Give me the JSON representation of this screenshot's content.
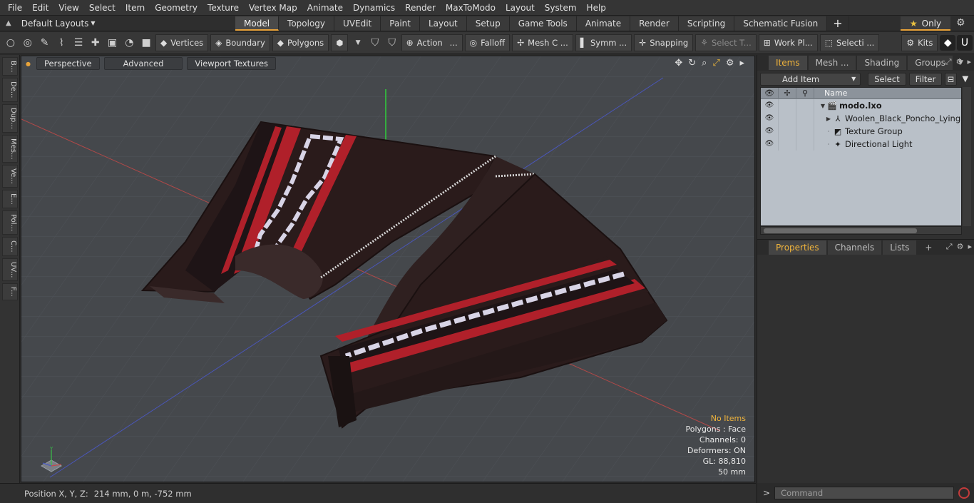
{
  "menu": [
    "File",
    "Edit",
    "View",
    "Select",
    "Item",
    "Geometry",
    "Texture",
    "Vertex Map",
    "Animate",
    "Dynamics",
    "Render",
    "MaxToModo",
    "Layout",
    "System",
    "Help"
  ],
  "layouts": {
    "label": "Default Layouts",
    "tabs": [
      "Model",
      "Topology",
      "UVEdit",
      "Paint",
      "Layout",
      "Setup",
      "Game Tools",
      "Animate",
      "Render",
      "Scripting",
      "Schematic Fusion"
    ],
    "active_tab": "Model",
    "plus": "+",
    "only_label": "Only"
  },
  "toolbar": {
    "vertices": "Vertices",
    "boundary": "Boundary",
    "polygons": "Polygons",
    "action": "Action",
    "falloff": "Falloff",
    "mesh": "Mesh C ...",
    "symm": "Symm ...",
    "snapping": "Snapping",
    "select_t": "Select T...",
    "work_pl": "Work Pl...",
    "selecti": "Selecti ...",
    "kits": "Kits"
  },
  "left_tabs": [
    "B...",
    "De...",
    "Dup...",
    "Mes...",
    "Ve...",
    "E...",
    "Pol...",
    "C...",
    "UV...",
    "F..."
  ],
  "viewport": {
    "view_mode": "Perspective",
    "advanced": "Advanced",
    "textures": "Viewport Textures",
    "stats": {
      "items": "No Items",
      "polygons": "Polygons : Face",
      "channels": "Channels: 0",
      "deformers": "Deformers: ON",
      "gl": "GL: 88,810",
      "scale": "50 mm"
    }
  },
  "status": {
    "label": "Position X, Y, Z:",
    "value": "214 mm, 0 m, -752 mm"
  },
  "items_panel": {
    "tabs": [
      "Items",
      "Mesh ...",
      "Shading",
      "Groups"
    ],
    "active_tab": "Items",
    "add_item": "Add Item",
    "select": "Select",
    "filter": "Filter",
    "column_name": "Name",
    "tree": [
      {
        "label": "modo.lxo",
        "icon": "scene-icon",
        "depth": 0
      },
      {
        "label": "Woolen_Black_Poncho_Lying",
        "icon": "mesh-icon",
        "depth": 1
      },
      {
        "label": "Texture Group",
        "icon": "texture-group-icon",
        "depth": 1
      },
      {
        "label": "Directional Light",
        "icon": "light-icon",
        "depth": 1
      }
    ]
  },
  "properties_panel": {
    "tabs": [
      "Properties",
      "Channels",
      "Lists"
    ],
    "active_tab": "Properties",
    "plus": "+"
  },
  "command": {
    "prompt": ">",
    "placeholder": "Command"
  },
  "colors": {
    "accent": "#e8a33a",
    "viewport_bg": "#45484c",
    "poncho": "#2a1c1c",
    "stripe_red": "#b0202a",
    "pattern_white": "#d8d4e6"
  }
}
